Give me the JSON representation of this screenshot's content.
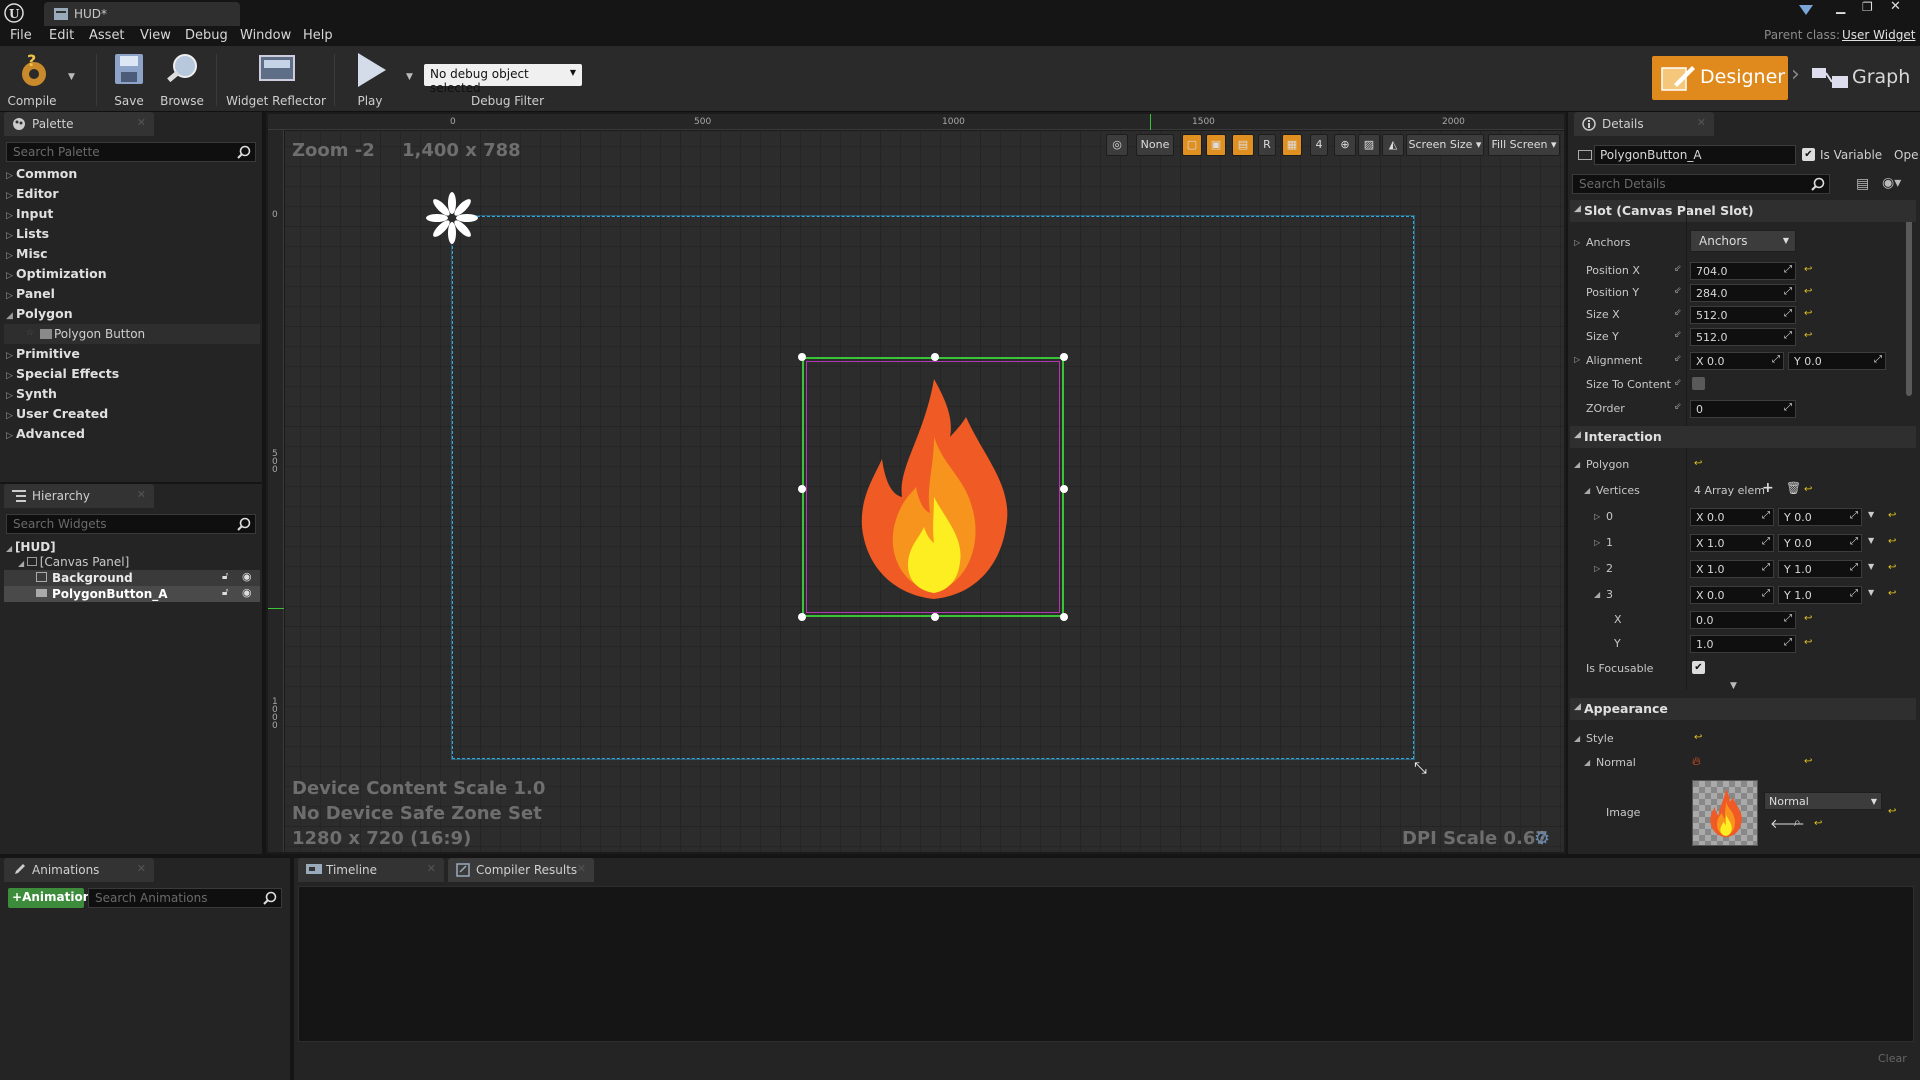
{
  "window": {
    "tab_title": "HUD*",
    "parent_class_label": "Parent class:",
    "parent_class_value": "User Widget"
  },
  "menu": [
    "File",
    "Edit",
    "Asset",
    "View",
    "Debug",
    "Window",
    "Help"
  ],
  "toolbar": {
    "compile": "Compile",
    "save": "Save",
    "browse": "Browse",
    "widget_reflector": "Widget Reflector",
    "play": "Play",
    "debug_select": "No debug object selected",
    "debug_filter": "Debug Filter",
    "designer": "Designer",
    "graph": "Graph"
  },
  "palette": {
    "tab": "Palette",
    "search_placeholder": "Search Palette",
    "items": [
      "Common",
      "Editor",
      "Input",
      "Lists",
      "Misc",
      "Optimization",
      "Panel",
      "Polygon",
      "Primitive",
      "Special Effects",
      "Synth",
      "User Created",
      "Advanced"
    ],
    "polygon_child": "Polygon Button"
  },
  "hierarchy": {
    "tab": "Hierarchy",
    "search_placeholder": "Search Widgets",
    "root": "[HUD]",
    "canvas": "[Canvas Panel]",
    "children": [
      "Background",
      "PolygonButton_A"
    ]
  },
  "viewport": {
    "zoom": "Zoom -2",
    "resolution": "1,400 x 788",
    "ruler_top": [
      "0",
      "500",
      "1000",
      "1500",
      "2000"
    ],
    "ruler_left": [
      "0",
      "5\n0\n0",
      "1\n0\n0\n0"
    ],
    "buttons": {
      "none": "None",
      "r": "R",
      "four": "4",
      "screen_size": "Screen Size",
      "fill_screen": "Fill Screen"
    },
    "device_scale": "Device Content Scale 1.0",
    "safe_zone": "No Device Safe Zone Set",
    "screen_res": "1280 x 720 (16:9)",
    "dpi_scale": "DPI Scale 0.67"
  },
  "details": {
    "tab": "Details",
    "widget_name": "PolygonButton_A",
    "is_variable": "Is Variable",
    "open_label": "Ope",
    "search_placeholder": "Search Details",
    "slot_section": "Slot (Canvas Panel Slot)",
    "anchors_label": "Anchors",
    "anchors_value": "Anchors",
    "position_x_label": "Position X",
    "position_x": "704.0",
    "position_y_label": "Position Y",
    "position_y": "284.0",
    "size_x_label": "Size X",
    "size_x": "512.0",
    "size_y_label": "Size Y",
    "size_y": "512.0",
    "alignment_label": "Alignment",
    "alignment_x": "0.0",
    "alignment_y": "0.0",
    "size_to_content_label": "Size To Content",
    "zorder_label": "ZOrder",
    "zorder": "0",
    "interaction_section": "Interaction",
    "polygon_label": "Polygon",
    "vertices_label": "Vertices",
    "vertices_count": "4 Array elem",
    "vertices": [
      {
        "idx": "0",
        "x": "0.0",
        "y": "0.0"
      },
      {
        "idx": "1",
        "x": "1.0",
        "y": "0.0"
      },
      {
        "idx": "2",
        "x": "1.0",
        "y": "1.0"
      },
      {
        "idx": "3",
        "x": "0.0",
        "y": "1.0"
      }
    ],
    "v3_x_label": "X",
    "v3_x": "0.0",
    "v3_y_label": "Y",
    "v3_y": "1.0",
    "is_focusable": "Is Focusable",
    "appearance_section": "Appearance",
    "style_label": "Style",
    "normal_label": "Normal",
    "image_label": "Image",
    "image_state": "Normal"
  },
  "bottom": {
    "animations_tab": "Animations",
    "add_animation": "Animation",
    "search_animations": "Search Animations",
    "timeline_tab": "Timeline",
    "compiler_tab": "Compiler Results",
    "clear": "Clear"
  },
  "colors": {
    "accent_orange": "#e08a1e",
    "selection_blue": "#35a8dc",
    "bounds_green": "#39c339",
    "bounds_magenta": "#b436b4"
  }
}
